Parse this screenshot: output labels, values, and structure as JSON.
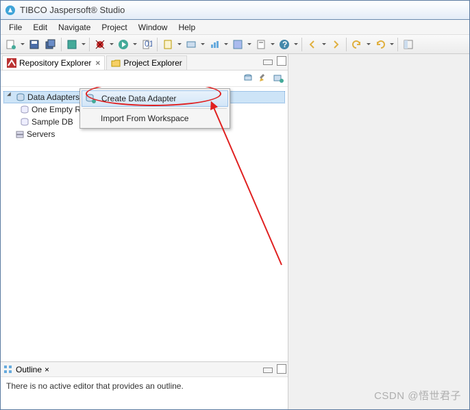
{
  "titlebar": {
    "title": "TIBCO Jaspersoft® Studio"
  },
  "menubar": {
    "items": [
      "File",
      "Edit",
      "Navigate",
      "Project",
      "Window",
      "Help"
    ]
  },
  "tabs": {
    "repository": {
      "label": "Repository Explorer"
    },
    "project": {
      "label": "Project Explorer"
    }
  },
  "tree": {
    "data_adapters": {
      "label": "Data Adapters"
    },
    "one_empty": {
      "label": "One Empty Record"
    },
    "sample_db": {
      "label": "Sample DB"
    },
    "servers": {
      "label": "Servers"
    }
  },
  "context_menu": {
    "create": "Create Data Adapter",
    "import": "Import From Workspace"
  },
  "outline": {
    "title": "Outline",
    "empty_text": "There is no active editor that provides an outline."
  },
  "watermark": "CSDN @悟世君子"
}
